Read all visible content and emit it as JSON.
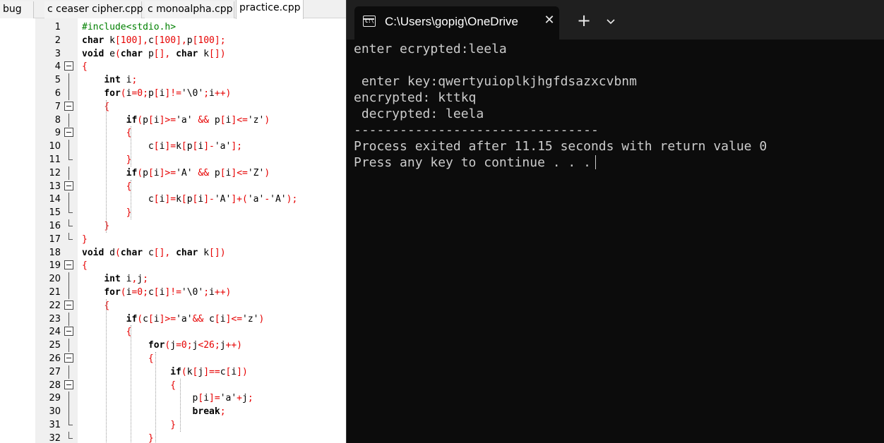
{
  "ide": {
    "tabs": [
      {
        "label": "bug",
        "active": false
      },
      {
        "label": "c ceaser cipher.cpp",
        "active": false
      },
      {
        "label": "c monoalpha.cpp",
        "active": false
      },
      {
        "label": "practice.cpp",
        "active": true
      }
    ],
    "line_numbers": [
      "1",
      "2",
      "3",
      "4",
      "5",
      "6",
      "7",
      "8",
      "9",
      "10",
      "11",
      "12",
      "13",
      "14",
      "15",
      "16",
      "17",
      "18",
      "19",
      "20",
      "21",
      "22",
      "23",
      "24",
      "25",
      "26",
      "27",
      "28",
      "29",
      "30",
      "31",
      "32"
    ],
    "code_lines": [
      "#include<stdio.h>",
      "char k[100],c[100],p[100];",
      "void e(char p[], char k[])",
      "{",
      "    int i;",
      "    for(i=0;p[i]!='\\0';i++)",
      "    {",
      "        if(p[i]>='a' && p[i]<='z')",
      "        {",
      "            c[i]=k[p[i]-'a'];",
      "        }",
      "        if(p[i]>='A' && p[i]<='Z')",
      "        {",
      "            c[i]=k[p[i]-'A']+('a'-'A');",
      "        }",
      "    }",
      "}",
      "void d(char c[], char k[])",
      "{",
      "    int i,j;",
      "    for(i=0;c[i]!='\\0';i++)",
      "    {",
      "        if(c[i]>='a'&& c[i]<='z')",
      "        {",
      "            for(j=0;j<26;j++)",
      "            {",
      "                if(k[j]==c[i])",
      "                {",
      "                    p[i]='a'+j;",
      "                    break;",
      "                }",
      "            }"
    ],
    "fold_markers": [
      "",
      "",
      "",
      "open",
      "line",
      "line",
      "open",
      "line",
      "open",
      "line",
      "end",
      "line",
      "open",
      "line",
      "end",
      "end",
      "end",
      "",
      "open",
      "line",
      "line",
      "open",
      "line",
      "open",
      "line",
      "open",
      "line",
      "open",
      "line",
      "line",
      "end",
      "end"
    ]
  },
  "terminal": {
    "tab_title": "C:\\Users\\gopig\\OneDrive",
    "tab_icon": "terminal-icon",
    "close_label": "✕",
    "new_tab_label": "+",
    "lines": [
      "enter ecrypted:leela",
      "",
      " enter key:qwertyuioplkjhgfdsazxcvbnm",
      "encrypted: kttkq",
      " decrypted: leela",
      "--------------------------------",
      "Process exited after 11.15 seconds with return value 0",
      "Press any key to continue . . ."
    ]
  },
  "colors": {
    "terminal_bg": "#0c0c0c",
    "terminal_titlebar": "#1f1f1f",
    "terminal_text": "#cccccc",
    "code_keyword": "#000000",
    "code_operator": "#e60000",
    "code_preprocessor": "#008000",
    "gutter_bg": "#f0f0f0"
  }
}
